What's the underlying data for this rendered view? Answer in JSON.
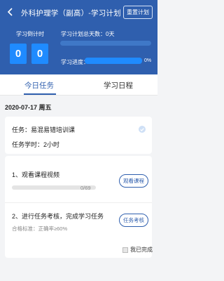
{
  "header": {
    "title": "外科护理学（副高）-学习计划",
    "reset_label": "重置计划",
    "countdown_label": "学习倒计时",
    "countdown_digits": [
      "0",
      "0"
    ],
    "days_label": "学习计划总天数：0天",
    "progress_label": "学习进度：",
    "progress_value": "0%",
    "progress_fraction": 0
  },
  "tabs": [
    {
      "label": "今日任务",
      "active": true
    },
    {
      "label": "学习日程",
      "active": false
    }
  ],
  "date": "2020-07-17  周五",
  "task": {
    "name": "任务：易混易错培训课",
    "hours": "任务学时：2小时"
  },
  "steps": [
    {
      "title": "1、观看课程视频",
      "count": "0/69",
      "progress_fraction": 0,
      "button_label": "观看课程"
    },
    {
      "title": "2、进行任务考核，完成学习任务",
      "subtitle": "合格标准：正确率≥60%",
      "button_label": "任务考核"
    }
  ],
  "done_label": "我已完成",
  "colors": {
    "header_blue": "#2f5fae",
    "accent_blue": "#1f8bff"
  }
}
